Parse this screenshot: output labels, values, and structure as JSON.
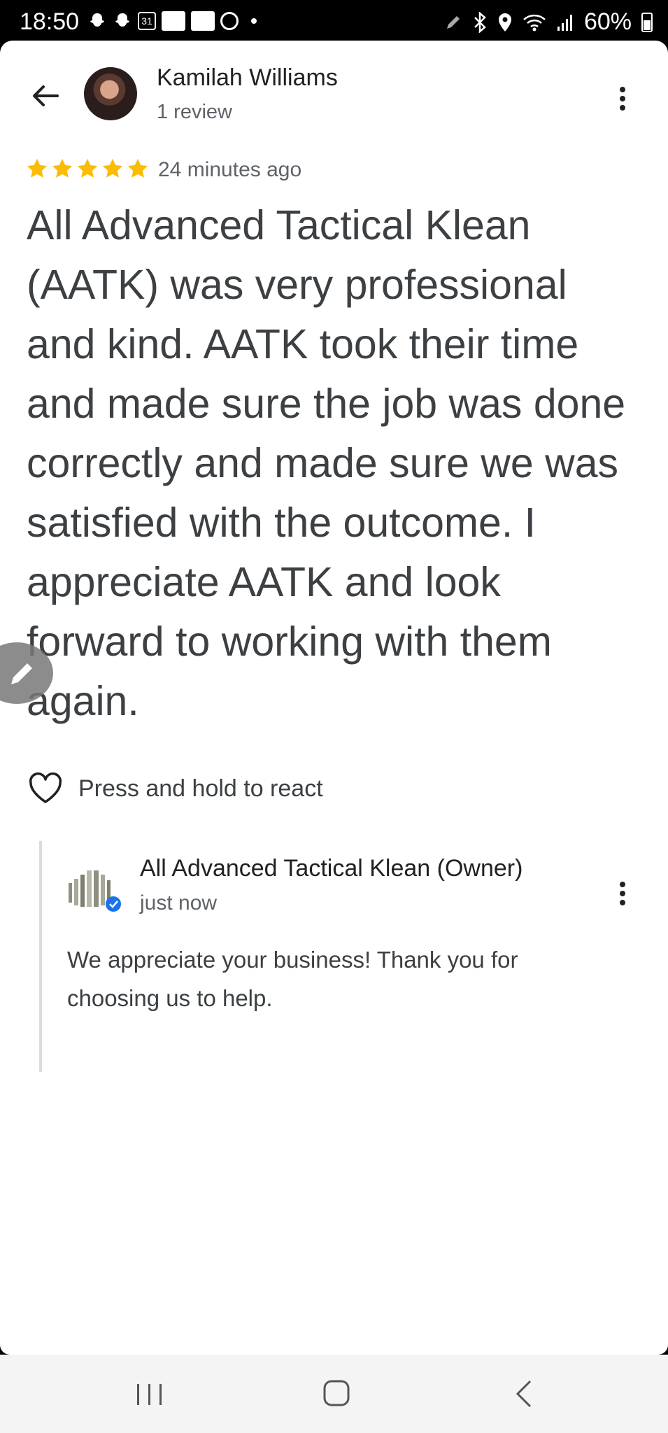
{
  "status_bar": {
    "time": "18:50",
    "calendar_day": "31",
    "battery": "60%",
    "icons": [
      "snapchat-icon",
      "snapchat-icon",
      "calendar-icon",
      "app-thumbnail-icon",
      "app-thumbnail-icon",
      "circle-icon",
      "dot-icon",
      "pen-icon",
      "bluetooth-icon",
      "location-icon",
      "wifi-icon",
      "signal-icon",
      "battery-icon"
    ]
  },
  "review": {
    "reviewer_name": "Kamilah Williams",
    "reviewer_meta": "1 review",
    "rating": 5,
    "time_ago": "24 minutes ago",
    "text": "All Advanced Tactical Klean (AATK) was very professional and kind. AATK took their time and made sure the job was done correctly and made sure we was satisfied with the outcome. I appreciate AATK and look forward to working with them again.",
    "react_label": "Press and hold to react"
  },
  "owner_reply": {
    "name": "All Advanced Tactical Klean (Owner)",
    "meta": "just now",
    "text": "We appreciate your business! Thank you for choosing us to help."
  },
  "colors": {
    "star": "#fbbc04",
    "verified_badge": "#1a73e8",
    "text_primary": "#202124",
    "text_secondary": "#5f6368"
  },
  "nav_bar": {
    "icons": [
      "recents-icon",
      "home-icon",
      "back-icon"
    ]
  }
}
